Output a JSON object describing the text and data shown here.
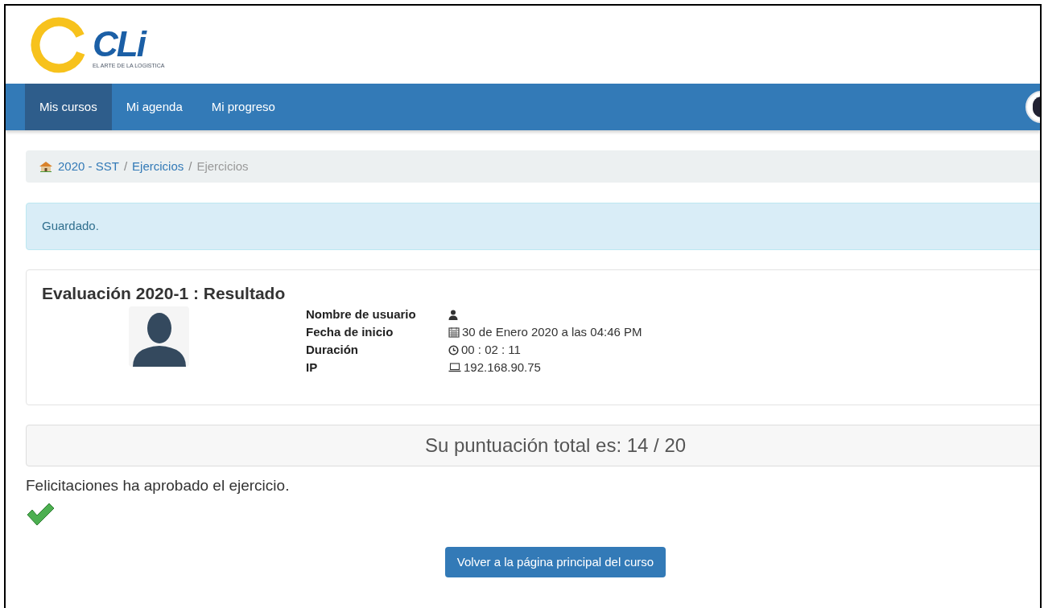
{
  "logo": {
    "mark": "CLi",
    "tagline": "EL ARTE DE LA LOGISTICA"
  },
  "nav": {
    "items": [
      {
        "label": "Mis cursos",
        "selected": true
      },
      {
        "label": "Mi agenda",
        "selected": false
      },
      {
        "label": "Mi progreso",
        "selected": false
      }
    ]
  },
  "breadcrumb_separator": "/",
  "breadcrumb": [
    {
      "label": "2020 - SST",
      "kind": "link"
    },
    {
      "label": "Ejercicios",
      "kind": "link"
    },
    {
      "label": "Ejercicios",
      "kind": "current"
    }
  ],
  "alert": "Guardado.",
  "result": {
    "title": "Evaluación 2020-1 : Resultado",
    "fields": [
      {
        "label": "Nombre de usuario",
        "kind": "user"
      },
      {
        "label": "Fecha de inicio",
        "kind": "calendar",
        "value": "30 de Enero 2020 a las 04:46 PM"
      },
      {
        "label": "Duración",
        "kind": "clock",
        "value": "00 : 02 : 11"
      },
      {
        "label": "IP",
        "kind": "laptop",
        "value": "192.168.90.75"
      }
    ]
  },
  "score": "Su puntuación total es: 14 / 20",
  "message": "Felicitaciones ha aprobado el ejercicio.",
  "passed": true,
  "button": "Volver a la página principal del curso"
}
